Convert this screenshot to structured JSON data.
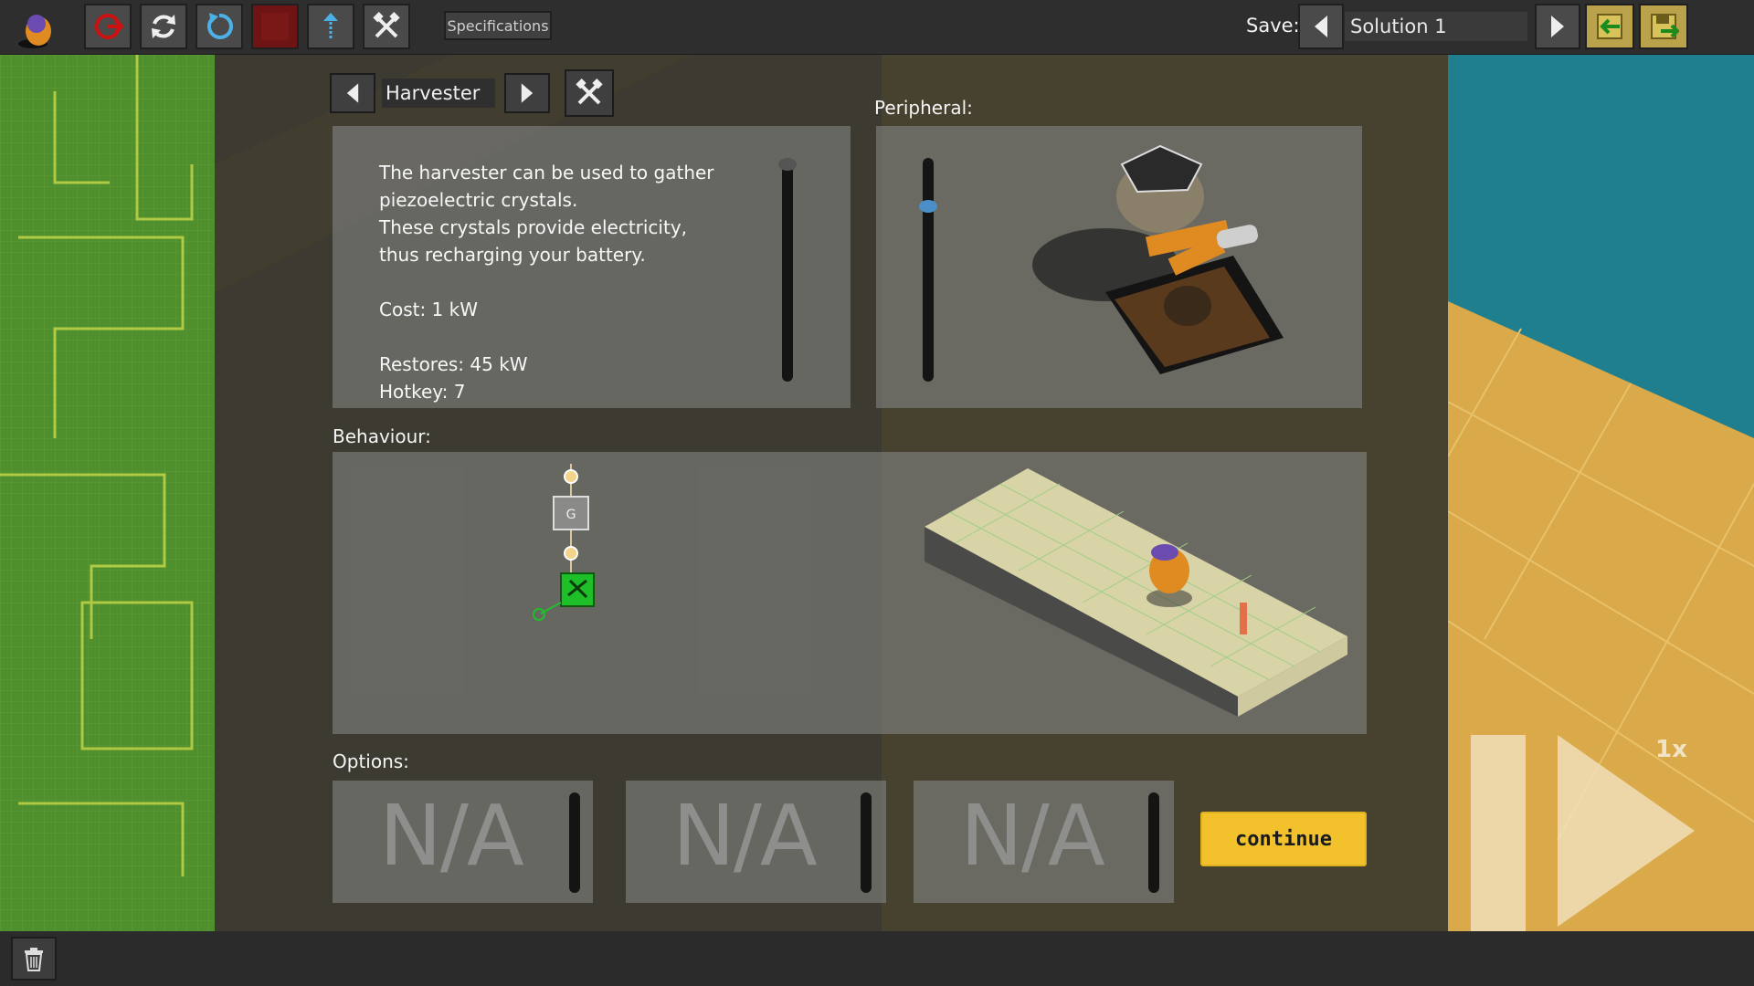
{
  "toolbar": {
    "specifications_label": "Specifications",
    "save_label": "Save:",
    "solution_name": "Solution 1"
  },
  "module": {
    "name": "Harvester",
    "description_lines": [
      "The harvester can be used to gather",
      "piezoelectric crystals.",
      "These crystals provide electricity,",
      "thus recharging your battery."
    ],
    "cost": "Cost: 1 kW",
    "restores": "Restores: 45 kW",
    "hotkey": "Hotkey: 7"
  },
  "sections": {
    "peripheral": "Peripheral:",
    "behaviour": "Behaviour:",
    "options": "Options:"
  },
  "options": [
    "N/A",
    "N/A",
    "N/A"
  ],
  "continue_label": "continue",
  "speed_label": "1x",
  "colors": {
    "accent_yellow": "#f2c12c",
    "record_red": "#8b1a1a",
    "node_green": "#1fbf2a",
    "toolbar_bg": "#2e2e2e"
  },
  "icons": {
    "logo": "robot-logo-icon",
    "exit": "exit-icon",
    "refresh": "refresh-icon",
    "undo": "undo-icon",
    "stop": "stop-icon",
    "upload": "upload-icon",
    "tools": "tools-icon",
    "prev": "chevron-left-icon",
    "next": "chevron-right-icon",
    "load": "load-icon",
    "save": "save-icon",
    "trash": "trash-icon"
  }
}
